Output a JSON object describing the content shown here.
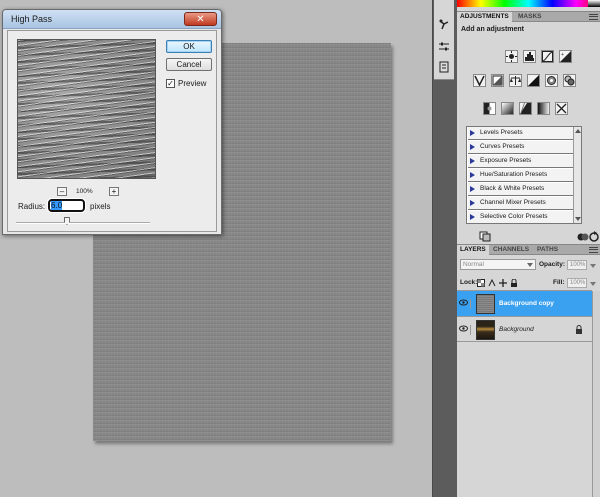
{
  "dialog": {
    "title": "High Pass",
    "close_glyph": "✕",
    "ok_label": "OK",
    "cancel_label": "Cancel",
    "preview_label": "Preview",
    "preview_checked": true,
    "preview_check_glyph": "✓",
    "zoom_minus": "–",
    "zoom_plus": "+",
    "zoom_level": "100%",
    "radius_label": "Radius:",
    "radius_value": "6.0",
    "radius_unit": "pixels",
    "radius_slider_fraction": 0.38
  },
  "adjustments_panel": {
    "tabs": [
      "ADJUSTMENTS",
      "MASKS"
    ],
    "heading": "Add an adjustment",
    "icons_row1": [
      "brightness-contrast-icon",
      "levels-icon",
      "curves-icon",
      "exposure-icon"
    ],
    "icons_row2": [
      "vibrance-icon",
      "hue-saturation-icon",
      "color-balance-icon",
      "black-white-icon",
      "photo-filter-icon",
      "channel-mixer-icon"
    ],
    "icons_row3": [
      "invert-icon",
      "posterize-icon",
      "threshold-icon",
      "gradient-map-icon",
      "selective-color-icon"
    ],
    "presets": [
      "Levels Presets",
      "Curves Presets",
      "Exposure Presets",
      "Hue/Saturation Presets",
      "Black & White Presets",
      "Channel Mixer Presets",
      "Selective Color Presets"
    ]
  },
  "layers_panel": {
    "tabs": [
      "LAYERS",
      "CHANNELS",
      "PATHS"
    ],
    "blend_mode": "Normal",
    "opacity_label": "Opacity:",
    "opacity_value": "100%",
    "fill_label": "Fill:",
    "fill_value": "100%",
    "lock_label": "Lock:",
    "layers": [
      {
        "name": "Background copy",
        "selected": true,
        "locked": false
      },
      {
        "name": "Background",
        "selected": false,
        "locked": true
      }
    ]
  },
  "colors": {
    "selection_blue": "#3aa0f0",
    "dialog_title_bg": "#b8d0ea",
    "close_red": "#c0391f",
    "preset_triangle": "#2a3a9a"
  }
}
